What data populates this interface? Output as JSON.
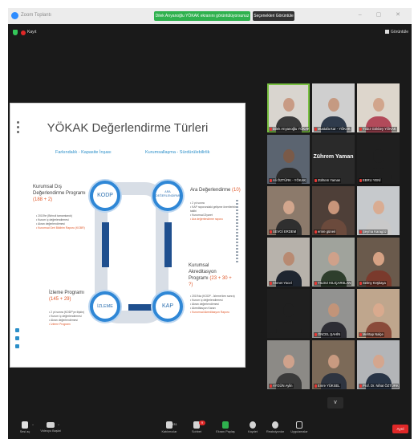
{
  "window": {
    "app_name": "Zoom Toplantı",
    "speaker_banner": "Dilek Arıyanoğlu YÖKAK ekranını görüntülüyorsunuz",
    "view_options": "Seçenekleri Görüntüle",
    "recording_label": "Kayıt",
    "gallery_view_label": "Görüntüle"
  },
  "slide": {
    "title": "YÖKAK Değerlendirme Türleri",
    "subtitle_left": "Farkındalık - Kapasite İnşası",
    "subtitle_right": "Kurumsallaşma - Sürdürülebilirlik",
    "kodp": {
      "heading": "Kurumsal Dış Değerlendirme Programı",
      "count": "(188 + 2)",
      "items": [
        "2015'te (Birincil tamamlandı)",
        "Kurum iç değerlendirmesi",
        "Akran değerlendirmesi",
        "Kurumsal Geri Bildirim Raporu (KGBR)"
      ]
    },
    "aa": {
      "heading": "Ara Değerlendirme",
      "count": "(10)",
      "items": [
        "2 yıl sonra",
        "KAP raporundaki gelişme önerilerinin takibi",
        "Kurumsal Ziyaret",
        "Ara değerlendirme raporu"
      ]
    },
    "izleme": {
      "heading": "İzleme Programı",
      "count": "(145 + 29)",
      "items": [
        "2 yıl sonra (KODP'ye ilişkin)",
        "Kurum iç değerlendirmesi",
        "Akran değerlendirmesi",
        "İzleme Programı"
      ]
    },
    "kap": {
      "heading": "Kurumsal Akreditasyon Programı",
      "count": "(23 + 30 + ?)",
      "items": [
        "2019'da (KODP - İzleme'den sonra)",
        "Kurum iç değerlendirmesi",
        "Akran değerlendirmesi",
        "Akreditasyon Kararı",
        "Kurumsal Akreditasyon Raporu"
      ]
    },
    "circle_kodp": "KODP",
    "circle_aa": "ARA DEĞERLENDİRME",
    "circle_izleme": "İZLEME",
    "circle_kap": "KAP"
  },
  "gallery": {
    "tiles": [
      {
        "name": "Dilek Arıyanoğlu YÖKAK",
        "speaking": true,
        "bg": "#d9d5cf",
        "skin": "#c89b84",
        "shirt": "#3a3a3a"
      },
      {
        "name": "Mustafa Kar - YÖKAK",
        "speaking": false,
        "bg": "#cfcfcf",
        "skin": "#c59a82",
        "shirt": "#2f3b4c"
      },
      {
        "name": "Yıldız Gökbey YÖKAK",
        "speaking": false,
        "bg": "#ddd6cc",
        "skin": "#d1a58c",
        "shirt": "#b24a5a"
      },
      {
        "name": "Ali ÖZTÜRK - YÖKAK",
        "speaking": false,
        "bg": "#5b6470",
        "skin": "#7a5a48",
        "shirt": "#2b2b2b"
      },
      {
        "name": "Zühtem Yaman",
        "speaking": false,
        "bg": "#2a2a2a",
        "big_name": "Zührem Yaman"
      },
      {
        "name": "EBRU YENİ",
        "speaking": false,
        "bg": "#1f1f1f",
        "skin": "#1f1f1f",
        "shirt": "#1f1f1f"
      },
      {
        "name": "SEVGİ ERDEM",
        "speaking": false,
        "bg": "#8c7a6b",
        "skin": "#d2a68d",
        "shirt": "#2f2f2f"
      },
      {
        "name": "emre güneri",
        "speaking": false,
        "bg": "#4e3f38",
        "skin": "#c8957a",
        "shirt": "#6b4a3c"
      },
      {
        "name": "Şeyma Karagöz",
        "speaking": false,
        "bg": "#c6c9cc",
        "skin": "#d9ac92",
        "shirt": "#c9c9c9"
      },
      {
        "name": "Ahmet Yücel",
        "speaking": false,
        "bg": "#b7b2ab",
        "skin": "#b88a72",
        "shirt": "#1e2530"
      },
      {
        "name": "YILDIZ KILIÇARSLAN",
        "speaking": false,
        "bg": "#a0a39c",
        "skin": "#cfa18a",
        "shirt": "#2e3e2c"
      },
      {
        "name": "Selmy Keşkaya",
        "speaking": false,
        "bg": "#6a5a4c",
        "skin": "#d6a284",
        "shirt": "#7a3a2c"
      },
      {
        "name": "",
        "speaking": false,
        "bg": "#1f1f1f",
        "skin": "#1f1f1f",
        "shirt": "#1f1f1f"
      },
      {
        "name": "ÖNCEL ŞAHİN",
        "speaking": false,
        "bg": "#939391",
        "skin": "#c29479",
        "shirt": "#2d2d34"
      },
      {
        "name": "Mehtap Nalçe",
        "speaking": false,
        "bg": "#bfa68d",
        "skin": "#d9aa8e",
        "shirt": "#8a4b3a"
      },
      {
        "name": "AYGÜN Aylin",
        "speaking": false,
        "bg": "#8c8a86",
        "skin": "#cfa28c",
        "shirt": "#3a3a3a"
      },
      {
        "name": "Emre YÜKSEL",
        "speaking": false,
        "bg": "#7c6a58",
        "skin": "#c89a80",
        "shirt": "#2e3440"
      },
      {
        "name": "Prof. Dr. Nihat ÖZTÜRK",
        "speaking": false,
        "bg": "#b3b5b8",
        "skin": "#d4a68e",
        "shirt": "#283446"
      }
    ]
  },
  "toolbar": {
    "mute": "Sesi aç",
    "video": "Videoyu Başlat",
    "participants": "Katılımcılar",
    "participant_count": "131",
    "chat": "Sohbet",
    "chat_badge": "9",
    "share": "Ekranı Paylaş",
    "record": "Kaydet",
    "reactions": "Reaksiyonlar",
    "apps": "Uygulamalar",
    "leave": "Ayrıl",
    "more": "v"
  }
}
